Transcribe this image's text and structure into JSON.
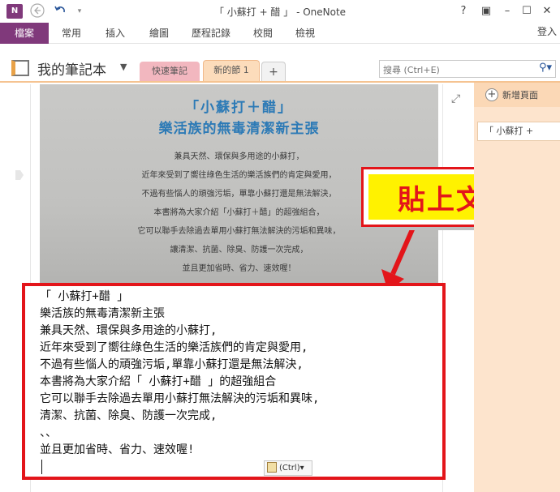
{
  "window": {
    "title": "「 小蘇打 + 醋 」 - OneNote",
    "app_icon": "N",
    "back_icon": "back-arrow-icon",
    "undo_icon": "undo-icon",
    "help": "?",
    "ribbon_display": "▣",
    "minimize": "–",
    "maximize": "☐",
    "close": "✕"
  },
  "ribbon": {
    "tabs": [
      "檔案",
      "常用",
      "插入",
      "繪圖",
      "歷程記錄",
      "校閱",
      "檢視"
    ],
    "login": "登入"
  },
  "notebook": {
    "name": "我的筆記本",
    "sections": [
      "快速筆記",
      "新的節 1"
    ],
    "add_section": "+",
    "search_placeholder": "搜尋 (Ctrl+E)"
  },
  "photo": {
    "title_line1": "「小蘇打＋醋」",
    "title_line2": "樂活族的無毒清潔新主張",
    "lines": [
      "兼具天然、環保與多用途的小蘇打，",
      "近年來受到了嚮往綠色生活的樂活族們的肯定與愛用，",
      "不過有些惱人的頑強污垢，單靠小蘇打還是無法解決，",
      "本書將為大家介紹「小蘇打＋醋」的超強組合，",
      "它可以聯手去除過去單用小蘇打無法解決的污垢和異味，",
      "讓清潔、抗菌、除臭、防護一次完成，",
      "並且更加省時、省力、速效喔！"
    ]
  },
  "callout": {
    "text": "貼上文字"
  },
  "pasted_text": {
    "lines": [
      "「 小蘇打+醋 」",
      "樂活族的無毒清潔新主張",
      "兼具天然、環保與多用途的小蘇打,",
      "近年來受到了嚮往綠色生活的樂活族們的肯定與愛用,",
      "不過有些惱人的頑強污垢,單靠小蘇打還是無法解決,",
      "本書將為大家介紹「 小蘇打+醋 」的超強組合",
      "它可以聯手去除過去單用小蘇打無法解決的污垢和異味,",
      "清潔、抗菌、除臭、防護一次完成,",
      "、、",
      "並且更加省時、省力、速效喔!"
    ],
    "paste_option": "(Ctrl)",
    "paste_chevron": "▾"
  },
  "right_panel": {
    "add_page": "新增頁面",
    "pages": [
      "「 小蘇打 +"
    ]
  },
  "colors": {
    "onenote_purple": "#80397b",
    "callout_red": "#e3151a",
    "callout_yellow": "#fff200",
    "page_panel": "#fde4cd"
  }
}
